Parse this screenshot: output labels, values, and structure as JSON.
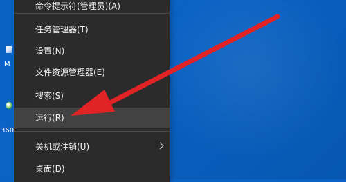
{
  "desktop": {
    "icons": [
      {
        "label": "M"
      },
      {
        "label": "360"
      }
    ]
  },
  "context_menu": {
    "items": [
      {
        "label": "命令提示符(管理员)(A)"
      },
      {
        "label": "任务管理器(T)"
      },
      {
        "label": "设置(N)"
      },
      {
        "label": "文件资源管理器(E)"
      },
      {
        "label": "搜索(S)"
      },
      {
        "label": "运行(R)"
      },
      {
        "label": "关机或注销(U)"
      },
      {
        "label": "桌面(D)"
      }
    ]
  },
  "colors": {
    "desktop": "#0a63c4",
    "menu_background": "#2b2b2b",
    "menu_highlight": "#424242",
    "annotation_arrow": "#e12326"
  },
  "icons": {
    "submenu": "chevron-right-icon",
    "desktop_1": "desktop-shortcut-icon",
    "desktop_2": "360-shortcut-icon",
    "annotation": "red-arrow-icon"
  }
}
